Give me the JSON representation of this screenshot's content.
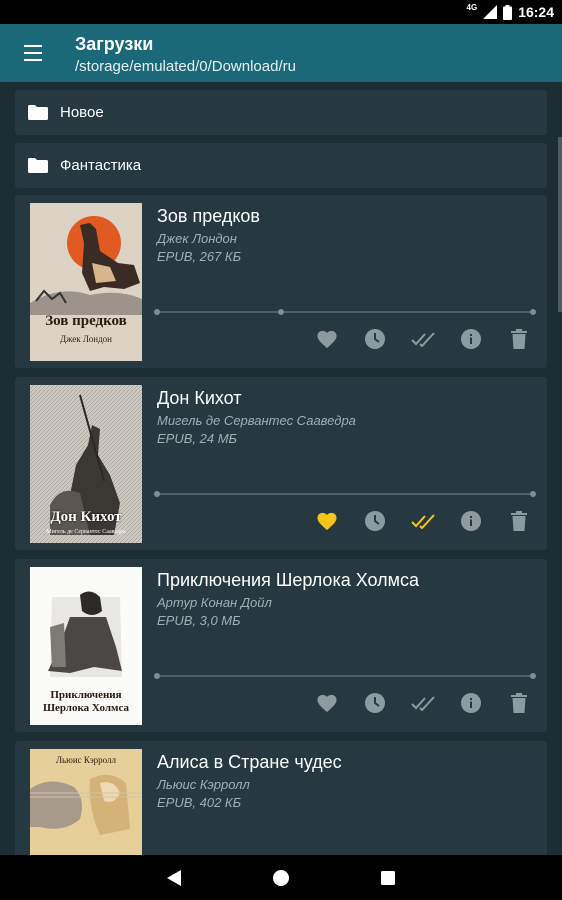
{
  "status_bar": {
    "time": "16:24",
    "network": "4G"
  },
  "app_bar": {
    "title": "Загрузки",
    "subtitle": "/storage/emulated/0/Download/ru"
  },
  "folders": [
    {
      "label": "Новое"
    },
    {
      "label": "Фантастика"
    }
  ],
  "books": [
    {
      "title": "Зов предков",
      "author": "Джек Лондон",
      "meta": "EPUB, 267 КБ",
      "cover_title": "Зов предков",
      "cover_author": "Джек Лондон",
      "favorite": false,
      "read": false
    },
    {
      "title": "Дон Кихот",
      "author": "Мигель де Сервантес Сааведра",
      "meta": "EPUB, 24 МБ",
      "cover_title": "Дон Кихот",
      "cover_author": "Мигель де Сервантес Сааведра",
      "favorite": true,
      "read": true
    },
    {
      "title": "Приключения Шерлока Холмса",
      "author": "Артур Конан Дойл",
      "meta": "EPUB, 3,0 МБ",
      "cover_title_line1": "Приключения",
      "cover_title_line2": "Шерлока Холмса",
      "favorite": false,
      "read": false
    },
    {
      "title": "Алиса в Стране чудес",
      "author": "Льюис Кэрролл",
      "meta": "EPUB, 402 КБ",
      "cover_author": "Льюис Кэрролл"
    }
  ],
  "icons": {
    "menu": "menu-icon",
    "folder": "folder-icon",
    "favorite": "heart-icon",
    "history": "clock-icon",
    "read": "double-check-icon",
    "info": "info-icon",
    "delete": "trash-icon"
  },
  "colors": {
    "app_bar": "#1a6878",
    "background": "#1c2d33",
    "card": "#263940",
    "accent": "#f5c518",
    "icon_inactive": "#8c9ba0"
  }
}
